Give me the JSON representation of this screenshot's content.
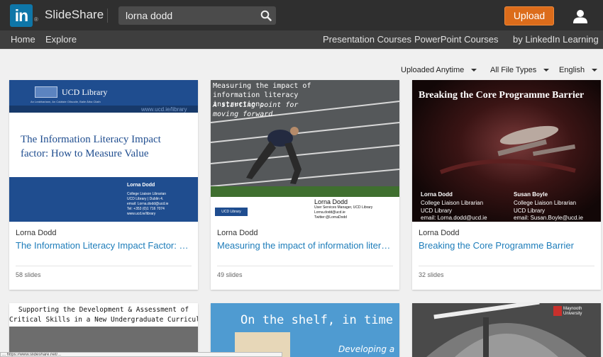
{
  "header": {
    "logo_text": "in",
    "logo_mark": "®",
    "brand": "SlideShare",
    "search_value": "lorna dodd",
    "search_icon": "search-icon",
    "upload_label": "Upload",
    "user_icon": "user-icon"
  },
  "nav": {
    "left": [
      "Home",
      "Explore"
    ],
    "right": [
      "Presentation Courses",
      "PowerPoint Courses",
      "by LinkedIn Learning"
    ]
  },
  "filters": [
    {
      "label": "Uploaded Anytime"
    },
    {
      "label": "All File Types"
    },
    {
      "label": "English"
    }
  ],
  "cards": [
    {
      "author": "Lorna Dodd",
      "title": "The Information Literacy Impact Factor: How to Measure Value",
      "slides": "58 slides",
      "thumb": {
        "header": "UCD Library",
        "header_sub": "An Leabharlann, An Coláiste Ollscoile, Baile Átha Cliath",
        "url": "www.ucd.ie/library",
        "title": "The Information Literacy Impact factor: How to Measure Value",
        "presenter": "Lorna Dodd",
        "details": [
          "College Liaison Librarian",
          "UCD Library | Dublin 4.",
          "email: Lorna.dodd@ucd.ie",
          "Tel: +353 (0)1 716 7074",
          "www.ucd.ie/library"
        ]
      }
    },
    {
      "author": "Lorna Dodd",
      "title": "Measuring the impact of information literacy instruction: A starting point for moving forward",
      "slides": "49 slides",
      "thumb": {
        "title": "Measuring the impact of information literacy instruction:",
        "subtitle": "A starting point for moving forward",
        "presenter": "Lorna Dodd",
        "details": [
          "User Services Manager, UCD Library",
          "Lorna.dodd@ucd.ie",
          "Twitter:@LornaDodd"
        ],
        "badge": "UCD Library"
      }
    },
    {
      "author": "Lorna Dodd",
      "title": "Breaking the Core Programme Barrier",
      "slides": "32 slides",
      "thumb": {
        "title": "Breaking the Core Programme Barrier",
        "left_name": "Lorna Dodd",
        "left_details": [
          "College Liaison Librarian",
          "UCD Library",
          "email: Lorna.dodd@ucd.ie"
        ],
        "right_name": "Susan Boyle",
        "right_details": [
          "College Liaison Librarian",
          "UCD Library",
          "email: Susan.Boyle@ucd.ie"
        ]
      }
    },
    {
      "thumb": {
        "title_lines": [
          "Supporting the Development & Assessment of",
          "Critical Skills in a New Undergraduate Curriculum"
        ]
      }
    },
    {
      "thumb": {
        "title": "On the shelf, in time",
        "subtitle": "Developing a"
      }
    },
    {
      "thumb": {
        "badge": "Maynooth University"
      }
    }
  ],
  "status_bar": "... https://www.slideshare.net/..."
}
